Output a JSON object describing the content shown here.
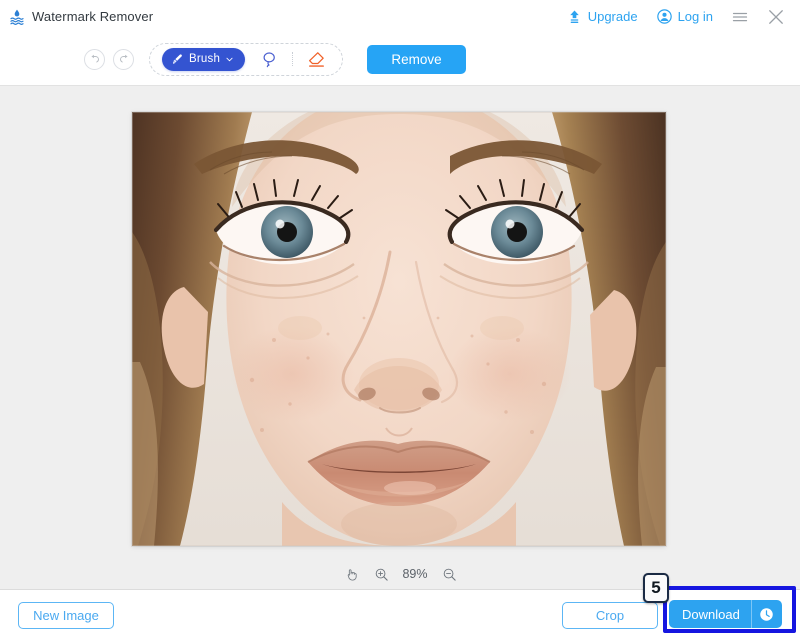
{
  "app": {
    "name": "Watermark Remover",
    "logo_icon": "watermark-droplet-icon"
  },
  "header": {
    "upgrade": {
      "label": "Upgrade",
      "icon": "upload-arrow-icon",
      "color": "#2da3f0"
    },
    "login": {
      "label": "Log in",
      "icon": "user-circle-icon",
      "color": "#2da3f0"
    },
    "menu": {
      "icon": "hamburger-menu-icon"
    },
    "close": {
      "icon": "close-x-icon"
    }
  },
  "toolbar": {
    "undo": {
      "icon": "undo-arrow-icon"
    },
    "redo": {
      "icon": "redo-arrow-icon"
    },
    "brush": {
      "label": "Brush",
      "icon": "brush-icon",
      "caret": "chevron-down-icon",
      "color": "#3454d1"
    },
    "lasso": {
      "icon": "lasso-icon",
      "color": "#4a5fd0"
    },
    "eraser": {
      "icon": "eraser-icon",
      "color": "#f0622a"
    },
    "remove": {
      "label": "Remove",
      "color": "#26a4f5"
    }
  },
  "canvas": {
    "image_alt": "close-up portrait photo of a young woman",
    "background_color": "#efefef"
  },
  "zoom_controls": {
    "pan": {
      "icon": "hand-pan-icon"
    },
    "zoom_in": {
      "icon": "magnifier-plus-icon"
    },
    "level": "89%",
    "zoom_out": {
      "icon": "magnifier-minus-icon"
    }
  },
  "bottom": {
    "new_image": {
      "label": "New Image"
    },
    "crop": {
      "label": "Crop"
    },
    "download": {
      "label": "Download",
      "icon": "clock-history-icon",
      "color": "#2da3f0"
    }
  },
  "annotation": {
    "step_number": "5",
    "highlight_color": "#1616e0"
  }
}
